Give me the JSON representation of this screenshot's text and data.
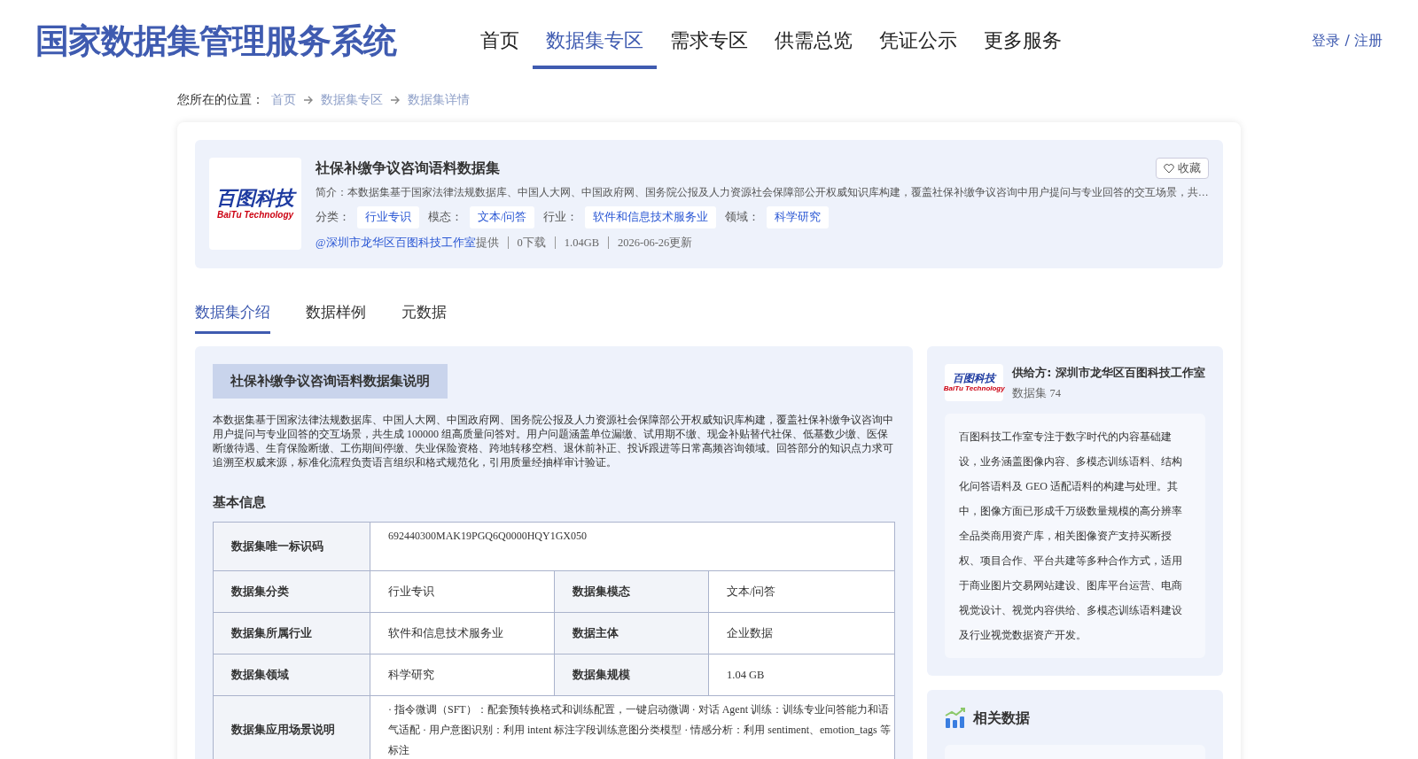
{
  "header": {
    "title": "国家数据集管理服务系统",
    "nav": [
      {
        "label": "首页",
        "selected": false
      },
      {
        "label": "数据集专区",
        "selected": true
      },
      {
        "label": "需求专区",
        "selected": false
      },
      {
        "label": "供需总览",
        "selected": false
      },
      {
        "label": "凭证公示",
        "selected": false
      },
      {
        "label": "更多服务",
        "selected": false
      }
    ],
    "login": "登录 / 注册"
  },
  "breadcrumb": {
    "label": "您所在的位置：",
    "items": [
      "首页",
      "数据集专区",
      "数据集详情"
    ]
  },
  "summary": {
    "logo": {
      "main": "百图科技",
      "sub": "BaiTu Technology"
    },
    "title": "社保补缴争议咨询语料数据集",
    "favorite": "收藏",
    "intro": "简介：本数据集基于国家法律法规数据库、中国人大网、中国政府网、国务院公报及人力资源社会保障部公开权威知识库构建，覆盖社保补缴争议咨询中用户提问与专业回答的交互场景，共…",
    "tags": [
      {
        "label": "分类：",
        "value": "行业专识"
      },
      {
        "label": "模态：",
        "value": "文本/问答"
      },
      {
        "label": "行业：",
        "value": "软件和信息技术服务业"
      },
      {
        "label": "领域：",
        "value": "科学研究"
      }
    ],
    "provider": "@深圳市龙华区百图科技工作室",
    "provided": "提供",
    "stats": [
      "0下载",
      "1.04GB",
      "2026-06-26更新"
    ]
  },
  "tabs": [
    {
      "label": "数据集介绍",
      "selected": true
    },
    {
      "label": "数据样例",
      "selected": false
    },
    {
      "label": "元数据",
      "selected": false
    }
  ],
  "description": {
    "heading": "社保补缴争议咨询语料数据集说明",
    "text": "本数据集基于国家法律法规数据库、中国人大网、中国政府网、国务院公报及人力资源社会保障部公开权威知识库构建，覆盖社保补缴争议咨询中用户提问与专业回答的交互场景，共生成 100000 组高质量问答对。用户问题涵盖单位漏缴、试用期不缴、现金补贴替代社保、低基数少缴、医保断缴待遇、生育保险断缴、工伤期间停缴、失业保险资格、跨地转移空档、退休前补正、投诉跟进等日常高频咨询领域。回答部分的知识点力求可追溯至权威来源，标准化流程负责语言组织和格式规范化，引用质量经抽样审计验证。"
  },
  "basic_info": {
    "heading": "基本信息",
    "rows": [
      [
        {
          "label": "数据集唯一标识码",
          "value": "692440300MAK19PGQ6Q0000HQY1GX050"
        }
      ],
      [
        {
          "label": "数据集分类",
          "value": "行业专识"
        },
        {
          "label": "数据集模态",
          "value": "文本/问答"
        }
      ],
      [
        {
          "label": "数据集所属行业",
          "value": "软件和信息技术服务业"
        },
        {
          "label": "数据主体",
          "value": "企业数据"
        }
      ],
      [
        {
          "label": "数据集领域",
          "value": "科学研究"
        },
        {
          "label": "数据集规模",
          "value": "1.04 GB"
        }
      ],
      [
        {
          "label": "数据集应用场景说明",
          "value": "· 指令微调（SFT）：配套预转换格式和训练配置，一键启动微调 · 对话 Agent 训练：训练专业问答能力和语气适配 · 用户意图识别：利用 intent 标注字段训练意图分类模型 · 情感分析：利用 sentiment、emotion_tags 等标注"
        }
      ]
    ]
  },
  "supplier": {
    "logo": {
      "main": "百图科技",
      "sub": "BaiTu Technology"
    },
    "name": "供给方: 深圳市龙华区百图科技工作室",
    "count": "数据集 74",
    "about": "百图科技工作室专注于数字时代的内容基础建设，业务涵盖图像内容、多模态训练语料、结构化问答语料及 GEO 适配语料的构建与处理。其中，图像方面已形成千万级数量规模的高分辨率全品类商用资产库，相关图像资产支持买断授权、项目合作、平台共建等多种合作方式，适用于商业图片交易网站建设、图库平台运营、电商视觉设计、视觉内容供给、多模态训练语料建设及行业视觉数据资产开发。"
  },
  "related": {
    "heading": "相关数据"
  }
}
